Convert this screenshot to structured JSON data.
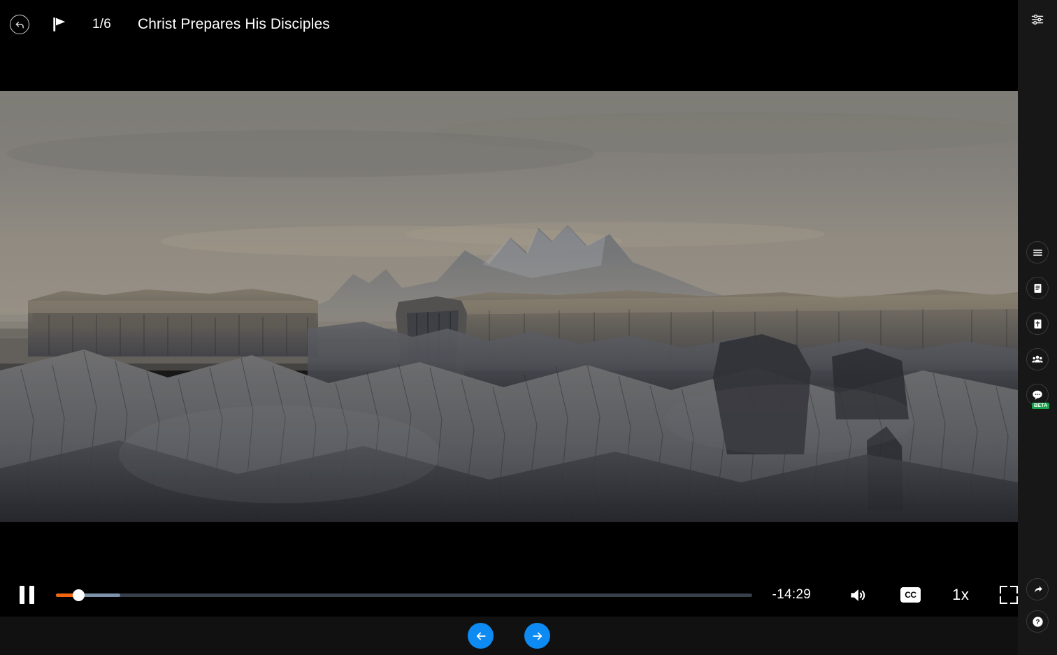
{
  "header": {
    "back_icon": "back-arrow-circle-icon",
    "flag_icon": "flag-icon",
    "chapter_counter": "1/6",
    "title": "Christ Prepares His Disciples"
  },
  "video": {
    "scene_description": "Desert badlands landscape with eroded gray sandstone mesas and distant hazy mountains under an overcast sky",
    "sky_top_color": "#8d8b84",
    "sky_bottom_color": "#a7a197",
    "mountain_color": "#7d838c",
    "mesa_light_color": "#8a8275",
    "rock_dark_color": "#3c3e44",
    "foreground_color": "#53555b"
  },
  "controls": {
    "play_state": "paused",
    "pause_label": "Pause",
    "time_remaining": "-14:29",
    "volume_icon": "volume-high-icon",
    "cc_label": "CC",
    "playback_speed": "1x",
    "fullscreen_icon": "fullscreen-icon",
    "progress": {
      "played_percent": 3.2,
      "buffered_percent": 9.2,
      "track_color": "#37404a",
      "buffer_color": "#7d91a8",
      "played_color": "#f4650c",
      "thumb_color": "#ffffff"
    }
  },
  "bottom_nav": {
    "accent_color": "#0d8bf2",
    "previous_label": "Previous",
    "previous_icon": "arrow-left-icon",
    "next_label": "Next",
    "next_icon": "arrow-right-icon"
  },
  "sidebar": {
    "background_color": "#171717",
    "settings": {
      "name": "settings-sliders-icon",
      "label": "Settings"
    },
    "items": [
      {
        "name": "menu-icon",
        "label": "Menu"
      },
      {
        "name": "notes-document-icon",
        "label": "Notes"
      },
      {
        "name": "scripture-cross-icon",
        "label": "Scriptures"
      },
      {
        "name": "people-group-icon",
        "label": "Participants"
      },
      {
        "name": "chat-bubble-icon",
        "label": "Chat",
        "badge": "BETA",
        "badge_color": "#19a34a"
      }
    ],
    "bottom_items": [
      {
        "name": "share-arrow-icon",
        "label": "Share"
      },
      {
        "name": "help-question-icon",
        "label": "Help"
      }
    ]
  }
}
